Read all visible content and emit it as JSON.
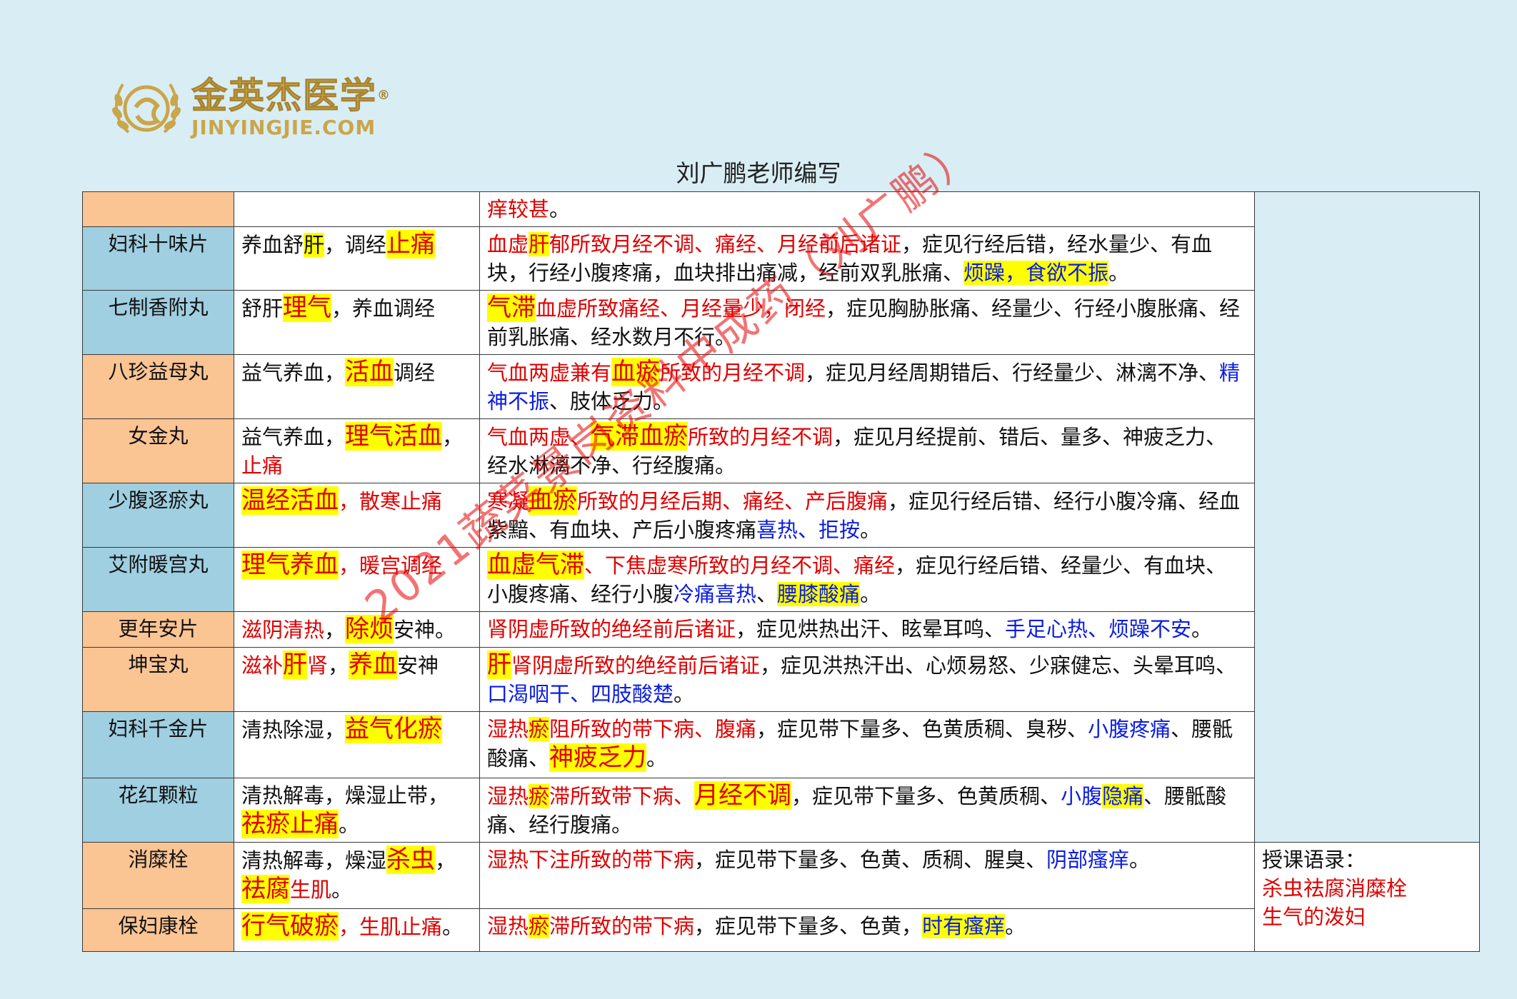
{
  "logo": {
    "cn": "金英杰医学",
    "en": "JINYINGJIE.COM",
    "reg": "®"
  },
  "author": "刘广鹏老师编写",
  "watermark": "2021蔬菜景岗资料中成药（刘广鹏）",
  "rows": [
    {
      "name": "",
      "func": [],
      "ind": [
        [
          "r",
          "痒较甚"
        ],
        [
          "k",
          "。"
        ]
      ],
      "color": "o"
    },
    {
      "name": "妇科十味片",
      "color": "b",
      "func": [
        [
          "k",
          "养血舒"
        ],
        [
          "hk",
          "肝"
        ],
        [
          "k",
          "，调经"
        ],
        [
          "hl",
          "止痛"
        ]
      ],
      "ind": [
        [
          "r",
          "血虚"
        ],
        [
          "hr",
          "肝"
        ],
        [
          "r",
          "郁所致月经不调、痛经、月经前后诸证"
        ],
        [
          "k",
          "，症见行经后错，经水量少、有血块，行经小腹疼痛，血块排出痛减，经前双乳胀痛、"
        ],
        [
          "hlb",
          "烦躁，食欲不振"
        ],
        [
          "k",
          "。"
        ]
      ]
    },
    {
      "name": "七制香附丸",
      "color": "b",
      "func": [
        [
          "k",
          "舒肝"
        ],
        [
          "hl",
          "理气"
        ],
        [
          "k",
          "，养血调经"
        ]
      ],
      "ind": [
        [
          "hl",
          "气滞"
        ],
        [
          "r",
          "血虚所致痛经、月经量少，闭经"
        ],
        [
          "k",
          "，症见胸胁胀痛、经量少、行经小腹胀痛、经前乳胀痛、经水数月不行。"
        ]
      ]
    },
    {
      "name": "八珍益母丸",
      "color": "o",
      "func": [
        [
          "k",
          "益气养血，"
        ],
        [
          "hl",
          "活血"
        ],
        [
          "k",
          "调经"
        ]
      ],
      "ind": [
        [
          "r",
          "气血两虚兼有"
        ],
        [
          "hl",
          "血瘀"
        ],
        [
          "r",
          "所致的月经不调"
        ],
        [
          "k",
          "，症见月经周期错后、行经量少、淋漓不净、"
        ],
        [
          "bl",
          "精神不振"
        ],
        [
          "k",
          "、肢体乏力。"
        ]
      ]
    },
    {
      "name": "女金丸",
      "color": "o",
      "func": [
        [
          "k",
          "益气养血，"
        ],
        [
          "hl",
          "理气活血"
        ],
        [
          "k",
          "，"
        ],
        [
          "r",
          "止痛"
        ]
      ],
      "ind": [
        [
          "r",
          "气血两虚、"
        ],
        [
          "hl",
          "气滞血瘀"
        ],
        [
          "r",
          "所致的月经不调"
        ],
        [
          "k",
          "，症见月经提前、错后、量多、神疲乏力、经水淋漓不净、行经腹痛。"
        ]
      ]
    },
    {
      "name": "少腹逐瘀丸",
      "color": "b",
      "func": [
        [
          "hl",
          "温经活血"
        ],
        [
          "r",
          "，散寒止痛"
        ]
      ],
      "ind": [
        [
          "r",
          "寒凝"
        ],
        [
          "hl",
          "血瘀"
        ],
        [
          "r",
          "所致的月经后期、痛经、产后腹痛"
        ],
        [
          "k",
          "，症见行经后错、经行小腹冷痛、经血紫黯、有血块、产后小腹疼痛"
        ],
        [
          "bl",
          "喜热、拒按"
        ],
        [
          "k",
          "。"
        ]
      ]
    },
    {
      "name": "艾附暖宫丸",
      "color": "b",
      "func": [
        [
          "hl",
          "理气养血"
        ],
        [
          "r",
          "，暖宫调经"
        ]
      ],
      "ind": [
        [
          "hl",
          "血虚气滞"
        ],
        [
          "r",
          "、下焦虚寒所致的月经不调、痛经"
        ],
        [
          "k",
          "，症见行经后错、经量少、有血块、小腹疼痛、经行小腹"
        ],
        [
          "bl",
          "冷痛喜热"
        ],
        [
          "k",
          "、"
        ],
        [
          "hlb",
          "腰膝酸痛"
        ],
        [
          "k",
          "。"
        ]
      ]
    },
    {
      "name": "更年安片",
      "color": "o",
      "func": [
        [
          "r",
          "滋阴清热"
        ],
        [
          "k",
          "，"
        ],
        [
          "hl",
          "除烦"
        ],
        [
          "k",
          "安神。"
        ]
      ],
      "ind": [
        [
          "r",
          "肾阴虚所致的绝经前后诸证"
        ],
        [
          "k",
          "，症见烘热出汗、眩晕耳鸣、"
        ],
        [
          "bl",
          "手足心热、烦躁不安"
        ],
        [
          "k",
          "。"
        ]
      ]
    },
    {
      "name": "坤宝丸",
      "color": "o",
      "func": [
        [
          "r",
          "滋补"
        ],
        [
          "hl",
          "肝"
        ],
        [
          "r",
          "肾"
        ],
        [
          "k",
          "，"
        ],
        [
          "hl",
          "养血"
        ],
        [
          "k",
          "安神"
        ]
      ],
      "ind": [
        [
          "hl",
          "肝"
        ],
        [
          "r",
          "肾阴虚所致的绝经前后诸证"
        ],
        [
          "k",
          "，症见洪热汗出、心烦易怒、少寐健忘、头晕耳鸣、"
        ],
        [
          "bl",
          "口渴咽干、四肢酸楚"
        ],
        [
          "k",
          "。"
        ]
      ]
    },
    {
      "name": "妇科千金片",
      "color": "b",
      "func": [
        [
          "k",
          "清热除湿，"
        ],
        [
          "hl",
          "益气化瘀"
        ]
      ],
      "ind": [
        [
          "r",
          "湿热"
        ],
        [
          "hr",
          "瘀"
        ],
        [
          "r",
          "阻所致的带下病、腹痛"
        ],
        [
          "k",
          "，症见带下量多、色黄质稠、臭秽、"
        ],
        [
          "bl",
          "小腹疼痛"
        ],
        [
          "k",
          "、腰骶酸痛、"
        ],
        [
          "hl",
          "神疲乏力"
        ],
        [
          "k",
          "。"
        ]
      ]
    },
    {
      "name": "花红颗粒",
      "color": "b",
      "func": [
        [
          "k",
          "清热解毒，燥湿止带，"
        ],
        [
          "hl",
          "祛瘀止痛"
        ],
        [
          "k",
          "。"
        ]
      ],
      "ind": [
        [
          "r",
          "湿热"
        ],
        [
          "hr",
          "瘀"
        ],
        [
          "r",
          "滞所致带下病、"
        ],
        [
          "hl",
          "月经不调"
        ],
        [
          "k",
          "，症见带下量多、色黄质稠、"
        ],
        [
          "bl",
          "小腹"
        ],
        [
          "hlb",
          "隐痛"
        ],
        [
          "k",
          "、腰骶酸痛、经行腹痛。"
        ]
      ]
    },
    {
      "name": "消糜栓",
      "color": "o",
      "func": [
        [
          "k",
          "清热解毒，燥湿"
        ],
        [
          "hl",
          "杀虫"
        ],
        [
          "k",
          "，"
        ],
        [
          "hl",
          "祛腐"
        ],
        [
          "r",
          "生肌"
        ],
        [
          "k",
          "。"
        ]
      ],
      "ind": [
        [
          "r",
          "湿热下注所致的带下病"
        ],
        [
          "k",
          "，症见带下量多、色黄、质稠、腥臭、"
        ],
        [
          "bl",
          "阴部瘙痒"
        ],
        [
          "k",
          "。"
        ]
      ]
    },
    {
      "name": "保妇康栓",
      "color": "o",
      "func": [
        [
          "hl",
          "行气破瘀"
        ],
        [
          "r",
          "，生肌止痛"
        ],
        [
          "k",
          "。"
        ]
      ],
      "ind": [
        [
          "r",
          "湿热"
        ],
        [
          "hr",
          "瘀"
        ],
        [
          "r",
          "滞所致的带下病"
        ],
        [
          "k",
          "，症见带下量多、色黄，"
        ],
        [
          "hlb",
          "时有瘙痒"
        ],
        [
          "k",
          "。"
        ]
      ]
    }
  ],
  "note": {
    "title": "授课语录：",
    "lines": [
      "杀虫祛腐消糜栓",
      "生气的泼妇"
    ]
  }
}
